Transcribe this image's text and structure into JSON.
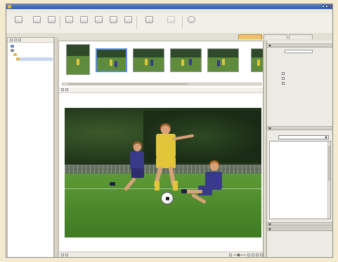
{
  "window": {
    "title": ""
  },
  "menu": [
    {
      "label": ""
    },
    {
      "label": ""
    },
    {
      "label": ""
    },
    {
      "label": ""
    },
    {
      "label": ""
    },
    {
      "label": ""
    },
    {
      "label": ""
    }
  ],
  "toolbar": {
    "buttons": [
      {
        "label": "",
        "icon": "camera-control-icon"
      },
      {
        "label": "",
        "icon": "transfer-icon"
      },
      {
        "label": "",
        "icon": "import-icon"
      },
      {
        "label": "",
        "icon": "print-icon"
      },
      {
        "label": "",
        "icon": "mail-icon"
      },
      {
        "label": "",
        "icon": "slideshow-icon"
      },
      {
        "label": "",
        "icon": "browse-icon"
      },
      {
        "label": "",
        "icon": "view-icon"
      },
      {
        "label": "",
        "icon": "edit-icon"
      },
      {
        "label": "",
        "icon": "disabled-tool-icon"
      },
      {
        "label": "",
        "icon": "help-icon"
      }
    ]
  },
  "view_tabs": [
    {
      "label": "",
      "active": true
    },
    {
      "label": "",
      "active": false
    },
    {
      "label": "",
      "active": false
    }
  ],
  "folder_tree": [
    {
      "label": "",
      "icon": "computer-icon"
    },
    {
      "label": "",
      "icon": "drive-icon"
    },
    {
      "label": "",
      "icon": "folder-icon"
    },
    {
      "label": "",
      "icon": "folder-icon",
      "selected": true
    }
  ],
  "filmstrip": {
    "thumbnails": [
      {
        "selected": false
      },
      {
        "selected": true
      },
      {
        "selected": false
      },
      {
        "selected": false
      },
      {
        "selected": false
      },
      {
        "selected": false
      }
    ]
  },
  "viewer": {
    "status": ""
  },
  "properties": {
    "header": "",
    "fields": [
      {
        "label": "",
        "value": ""
      },
      {
        "label": "",
        "value": ""
      },
      {
        "label": "",
        "value": ""
      },
      {
        "label": "",
        "value": ""
      }
    ],
    "protection_label": "",
    "options": [
      {
        "label": ""
      },
      {
        "label": ""
      },
      {
        "label": ""
      }
    ]
  },
  "information": {
    "header": "",
    "show_label": "",
    "show_value": "",
    "lines": [
      "",
      "",
      "",
      "",
      "",
      "",
      "",
      "",
      "",
      "",
      "",
      "",
      "",
      "",
      "",
      "",
      "",
      "",
      "",
      "",
      "",
      "",
      "",
      "",
      "",
      "",
      "",
      "",
      ""
    ]
  },
  "panels": [
    {
      "label": ""
    },
    {
      "label": ""
    }
  ],
  "colors": {
    "title_bar": "#2f5aa8",
    "active_tab": "#f3c16a",
    "selection": "#5a8fd6",
    "jersey_yellow": "#e3c53a",
    "jersey_blue": "#3a3a8a"
  }
}
